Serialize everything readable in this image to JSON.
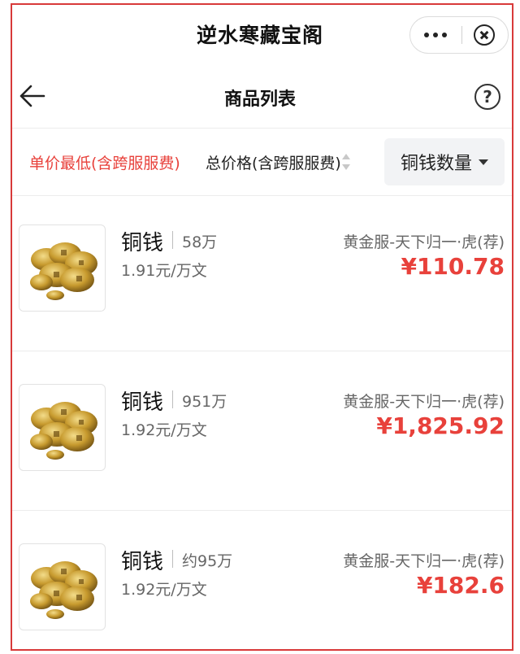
{
  "app": {
    "title": "逆水寒藏宝阁"
  },
  "nav": {
    "title": "商品列表",
    "help_label": "?"
  },
  "sort": {
    "unit_price_label": "单价最低(含跨服服费)",
    "total_price_label": "总价格(含跨服服费)",
    "filter_label": "铜钱数量"
  },
  "colors": {
    "accent_red": "#e8413b",
    "frame_red": "#d83a3a"
  },
  "listings": [
    {
      "name": "铜钱",
      "quantity": "58万",
      "unit_price": "1.91元/万文",
      "server": "黄金服-天下归一·虎(荐)",
      "price": "¥110.78",
      "image_icon": "copper-coins-image"
    },
    {
      "name": "铜钱",
      "quantity": "951万",
      "unit_price": "1.92元/万文",
      "server": "黄金服-天下归一·虎(荐)",
      "price": "¥1,825.92",
      "image_icon": "copper-coins-image"
    },
    {
      "name": "铜钱",
      "quantity": "约95万",
      "unit_price": "1.92元/万文",
      "server": "黄金服-天下归一·虎(荐)",
      "price": "¥182.6",
      "image_icon": "copper-coins-image"
    }
  ]
}
